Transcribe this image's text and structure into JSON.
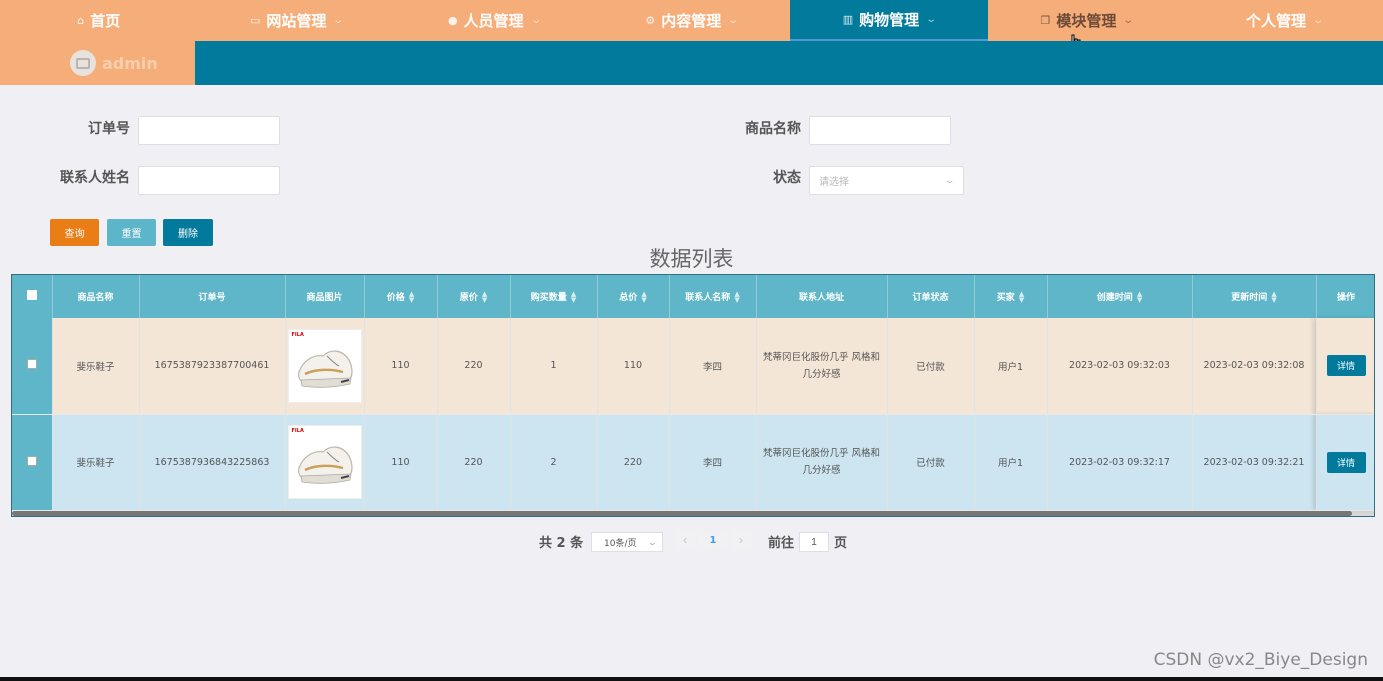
{
  "nav": {
    "items": [
      {
        "label": "首页",
        "icon": "home-icon",
        "glyph": "⌂",
        "dropdown": false
      },
      {
        "label": "网站管理",
        "icon": "monitor-icon",
        "glyph": "▭",
        "dropdown": true
      },
      {
        "label": "人员管理",
        "icon": "user-icon",
        "glyph": "●",
        "dropdown": true
      },
      {
        "label": "内容管理",
        "icon": "gear-icon",
        "glyph": "⚙",
        "dropdown": true
      },
      {
        "label": "购物管理",
        "icon": "store-icon",
        "glyph": "▥",
        "dropdown": true,
        "active": true
      },
      {
        "label": "模块管理",
        "icon": "copy-icon",
        "glyph": "❐",
        "dropdown": true
      },
      {
        "label": "个人管理",
        "icon": "",
        "glyph": "",
        "dropdown": true
      }
    ],
    "colors": {
      "nav_bg": "#f5ad7a",
      "active_bg": "#027a9c"
    }
  },
  "user": {
    "name": "admin"
  },
  "search": {
    "order_no_label": "订单号",
    "product_name_label": "商品名称",
    "contact_name_label": "联系人姓名",
    "status_label": "状态",
    "status_placeholder": "请选择"
  },
  "buttons": {
    "query": "查询",
    "reset": "重置",
    "delete": "删除"
  },
  "list_title": "数据列表",
  "table": {
    "columns": [
      {
        "label": "",
        "type": "checkbox"
      },
      {
        "label": "商品名称",
        "sortable": false
      },
      {
        "label": "订单号",
        "sortable": false
      },
      {
        "label": "商品图片",
        "sortable": false
      },
      {
        "label": "价格",
        "sortable": true
      },
      {
        "label": "原价",
        "sortable": true
      },
      {
        "label": "购买数量",
        "sortable": true
      },
      {
        "label": "总价",
        "sortable": true
      },
      {
        "label": "联系人名称",
        "sortable": true
      },
      {
        "label": "联系人地址",
        "sortable": false
      },
      {
        "label": "订单状态",
        "sortable": false
      },
      {
        "label": "买家",
        "sortable": true
      },
      {
        "label": "创建时间",
        "sortable": true
      },
      {
        "label": "更新时间",
        "sortable": true
      },
      {
        "label": "操作",
        "sortable": false
      }
    ],
    "rows": [
      {
        "product_name": "斐乐鞋子",
        "order_no": "1675387923387700461",
        "image_brand": "FILA",
        "price": "110",
        "original_price": "220",
        "quantity": "1",
        "total": "110",
        "contact_name": "李四",
        "contact_address": "梵蒂冈巨化股份几乎 风格和几分好感",
        "status": "已付款",
        "buyer": "用户1",
        "created": "2023-02-03 09:32:03",
        "updated": "2023-02-03 09:32:08",
        "action": "详情"
      },
      {
        "product_name": "斐乐鞋子",
        "order_no": "1675387936843225863",
        "image_brand": "FILA",
        "price": "110",
        "original_price": "220",
        "quantity": "2",
        "total": "220",
        "contact_name": "李四",
        "contact_address": "梵蒂冈巨化股份几乎 风格和几分好感",
        "status": "已付款",
        "buyer": "用户1",
        "created": "2023-02-03 09:32:17",
        "updated": "2023-02-03 09:32:21",
        "action": "详情"
      }
    ]
  },
  "pagination": {
    "total_text": "共 2 条",
    "page_size": "10条/页",
    "current_page": "1",
    "goto_label": "前往",
    "goto_value": "1",
    "page_unit": "页",
    "prev": "‹",
    "next": "›"
  },
  "watermark": "CSDN @vx2_Biye_Design"
}
